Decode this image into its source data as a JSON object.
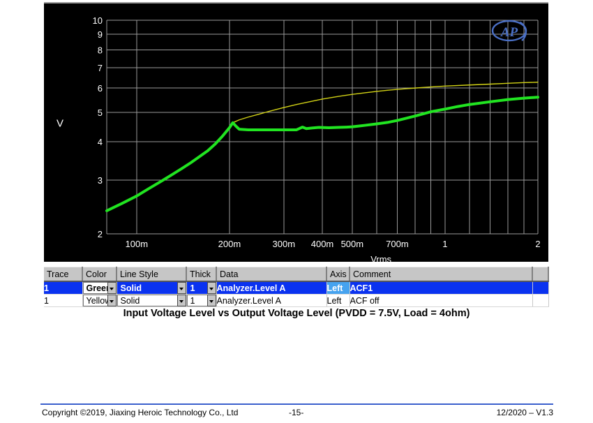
{
  "chart_data": {
    "type": "line",
    "title": "",
    "xlabel": "Vrms",
    "ylabel": "V",
    "xscale": "log",
    "yscale": "log",
    "xlim": [
      0.08,
      2.0
    ],
    "ylim": [
      2,
      10
    ],
    "grid": true,
    "background": "#000000",
    "grid_color": "#9a9a9a",
    "tick_color": "#ffffff",
    "x_ticks": [
      {
        "value": 0.1,
        "label": "100m"
      },
      {
        "value": 0.2,
        "label": "200m"
      },
      {
        "value": 0.3,
        "label": "300m"
      },
      {
        "value": 0.4,
        "label": "400m"
      },
      {
        "value": 0.5,
        "label": "500m"
      },
      {
        "value": 0.7,
        "label": "700m"
      },
      {
        "value": 1.0,
        "label": "1"
      },
      {
        "value": 2.0,
        "label": "2"
      }
    ],
    "y_ticks": [
      {
        "value": 2,
        "label": "2"
      },
      {
        "value": 3,
        "label": "3"
      },
      {
        "value": 4,
        "label": "4"
      },
      {
        "value": 5,
        "label": "5"
      },
      {
        "value": 6,
        "label": "6"
      },
      {
        "value": 7,
        "label": "7"
      },
      {
        "value": 8,
        "label": "8"
      },
      {
        "value": 9,
        "label": "9"
      },
      {
        "value": 10,
        "label": "10"
      }
    ],
    "logo": "AP",
    "series": [
      {
        "name": "Analyzer.Level A (ACF1)",
        "color": "#21e421",
        "width": 4,
        "points": [
          [
            0.08,
            2.38
          ],
          [
            0.09,
            2.52
          ],
          [
            0.1,
            2.66
          ],
          [
            0.11,
            2.82
          ],
          [
            0.12,
            2.97
          ],
          [
            0.13,
            3.12
          ],
          [
            0.14,
            3.27
          ],
          [
            0.15,
            3.42
          ],
          [
            0.16,
            3.58
          ],
          [
            0.17,
            3.74
          ],
          [
            0.18,
            3.94
          ],
          [
            0.19,
            4.18
          ],
          [
            0.2,
            4.45
          ],
          [
            0.205,
            4.62
          ],
          [
            0.21,
            4.5
          ],
          [
            0.215,
            4.4
          ],
          [
            0.23,
            4.38
          ],
          [
            0.26,
            4.38
          ],
          [
            0.3,
            4.38
          ],
          [
            0.33,
            4.38
          ],
          [
            0.345,
            4.47
          ],
          [
            0.355,
            4.42
          ],
          [
            0.37,
            4.44
          ],
          [
            0.39,
            4.46
          ],
          [
            0.42,
            4.45
          ],
          [
            0.45,
            4.46
          ],
          [
            0.48,
            4.47
          ],
          [
            0.5,
            4.48
          ],
          [
            0.55,
            4.53
          ],
          [
            0.6,
            4.58
          ],
          [
            0.65,
            4.63
          ],
          [
            0.7,
            4.7
          ],
          [
            0.75,
            4.78
          ],
          [
            0.8,
            4.86
          ],
          [
            0.85,
            4.94
          ],
          [
            0.9,
            5.02
          ],
          [
            1.0,
            5.12
          ],
          [
            1.1,
            5.22
          ],
          [
            1.2,
            5.3
          ],
          [
            1.4,
            5.41
          ],
          [
            1.6,
            5.5
          ],
          [
            1.8,
            5.56
          ],
          [
            2.0,
            5.6
          ]
        ]
      },
      {
        "name": "Analyzer.Level A (ACF off)",
        "color": "#d2d215",
        "width": 1.4,
        "points": [
          [
            0.2,
            4.45
          ],
          [
            0.205,
            4.62
          ],
          [
            0.215,
            4.72
          ],
          [
            0.23,
            4.82
          ],
          [
            0.25,
            4.93
          ],
          [
            0.27,
            5.04
          ],
          [
            0.3,
            5.18
          ],
          [
            0.33,
            5.3
          ],
          [
            0.36,
            5.4
          ],
          [
            0.4,
            5.52
          ],
          [
            0.45,
            5.63
          ],
          [
            0.5,
            5.72
          ],
          [
            0.55,
            5.79
          ],
          [
            0.6,
            5.85
          ],
          [
            0.65,
            5.9
          ],
          [
            0.7,
            5.94
          ],
          [
            0.8,
            6.0
          ],
          [
            0.9,
            6.05
          ],
          [
            1.0,
            6.09
          ],
          [
            1.2,
            6.14
          ],
          [
            1.4,
            6.18
          ],
          [
            1.6,
            6.22
          ],
          [
            1.8,
            6.25
          ],
          [
            2.0,
            6.27
          ]
        ]
      }
    ]
  },
  "trace_table": {
    "columns": [
      "Trace",
      "Color",
      "Line Style",
      "Thick",
      "Data",
      "Axis",
      "Comment"
    ],
    "rows": [
      {
        "trace": "1",
        "color": "Green",
        "line_style": "Solid",
        "thick": "1",
        "data": "Analyzer.Level A",
        "axis": "Left",
        "comment": "ACF1",
        "selected": true
      },
      {
        "trace": "1",
        "color": "Yellow",
        "line_style": "Solid",
        "thick": "1",
        "data": "Analyzer.Level A",
        "axis": "Left",
        "comment": "ACF  off",
        "selected": false
      }
    ]
  },
  "caption": "Input Voltage Level vs Output Voltage Level (PVDD = 7.5V, Load = 4ohm)",
  "footer": {
    "copyright": "Copyright ©2019, Jiaxing Heroic Technology Co., Ltd",
    "page": "-15-",
    "version": "12/2020 – V1.3"
  }
}
